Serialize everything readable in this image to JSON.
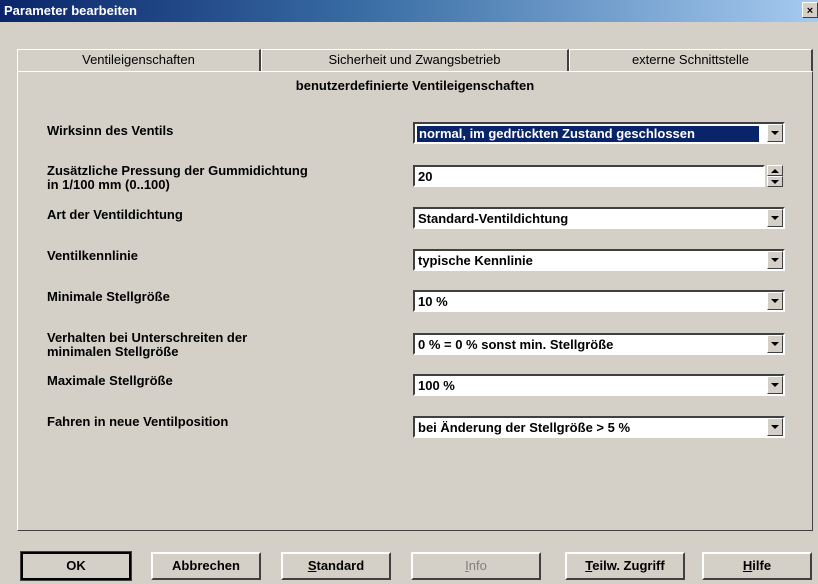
{
  "window": {
    "title": "Parameter bearbeiten",
    "close_glyph": "×"
  },
  "tabs": [
    {
      "label": "Ventileigenschaften"
    },
    {
      "label": "Sicherheit und Zwangsbetrieb"
    },
    {
      "label": "externe Schnittstelle"
    }
  ],
  "section_heading": "benutzerdefinierte Ventileigenschaften",
  "params": {
    "wirksinn": {
      "label": "Wirksinn des Ventils",
      "value": "normal, im gedrückten Zustand geschlossen"
    },
    "pressung": {
      "label_line1": "Zusätzliche Pressung der Gummidichtung",
      "label_line2": "in 1/100 mm (0..100)",
      "value": "20"
    },
    "dichtung": {
      "label": "Art der Ventildichtung",
      "value": "Standard-Ventildichtung"
    },
    "kennlinie": {
      "label": "Ventilkennlinie",
      "value": "typische Kennlinie"
    },
    "min_stell": {
      "label": "Minimale Stellgröße",
      "value": "10 %"
    },
    "unterschreiten": {
      "label_line1": "Verhalten bei Unterschreiten der",
      "label_line2": "minimalen Stellgröße",
      "value": "0 % = 0 % sonst min. Stellgröße"
    },
    "max_stell": {
      "label": "Maximale Stellgröße",
      "value": "100 %"
    },
    "fahren": {
      "label": "Fahren in neue Ventilposition",
      "value": "bei Änderung der Stellgröße > 5 %"
    }
  },
  "buttons": {
    "ok": "OK",
    "abbrechen": "Abbrechen",
    "standard_u": "S",
    "standard_rest": "tandard",
    "info_u": "I",
    "info_rest": "nfo",
    "teilw_u": "T",
    "teilw_rest": "eilw. Zugriff",
    "hilfe_u": "H",
    "hilfe_rest": "ilfe"
  }
}
